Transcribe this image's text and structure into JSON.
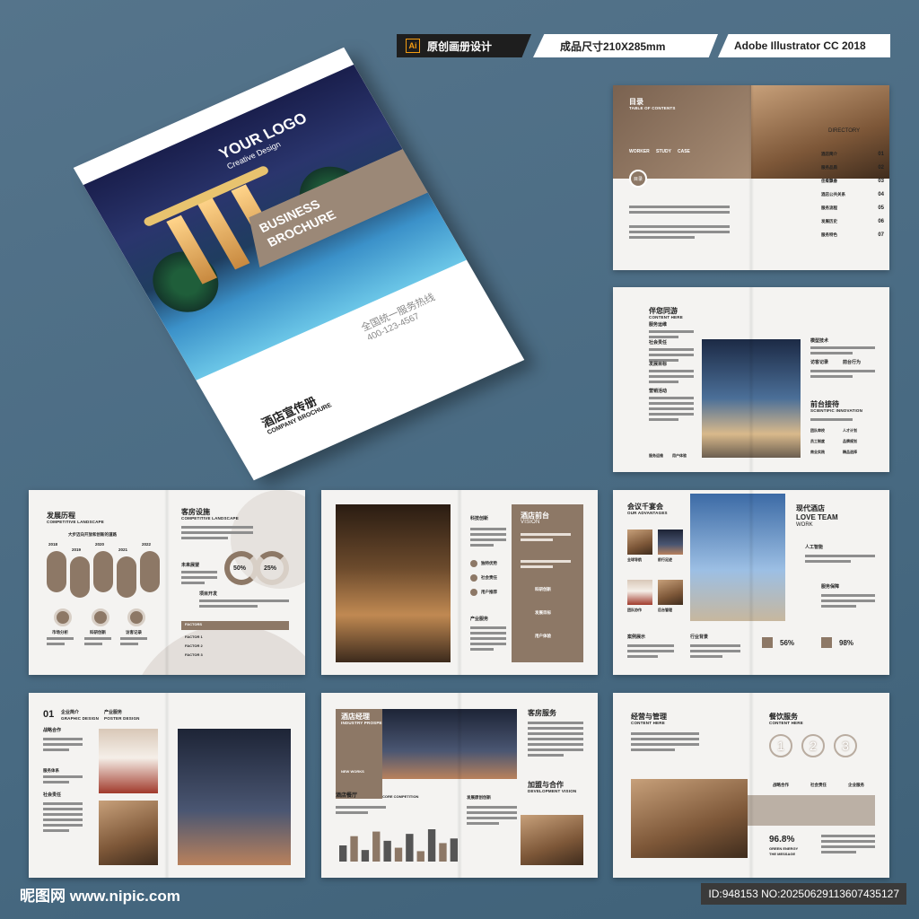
{
  "badges": {
    "tool": "Ai",
    "design": "原创画册设计",
    "size": "成品尺寸210X285mm",
    "software": "Adobe Illustrator CC 2018"
  },
  "cover": {
    "logo": "YOUR LOGO",
    "logo_sub": "Creative Design",
    "band_line1": "BUSINESS",
    "band_line2": "BROCHURE",
    "hotline_label": "全国统一服务热线",
    "hotline_number": "400-123-4567",
    "title": "酒店宣传册",
    "title_sub": "COMPANY BROCHURE"
  },
  "toc": {
    "title": "目录",
    "subtitle": "TABLE OF CONTENTS",
    "tabs": [
      "WORKER",
      "STUDY",
      "CASE"
    ],
    "chip": "目录",
    "directory": "DIRECTORY",
    "items": [
      {
        "label": "酒店简介",
        "sub": "PREFACE",
        "num": "01"
      },
      {
        "label": "服务品质",
        "sub": "COMPANY PROFILE",
        "num": "02"
      },
      {
        "label": "佳肴飘香",
        "sub": "OUR TEAM",
        "num": "03"
      },
      {
        "label": "酒店公共关系",
        "sub": "OUR SERVICE",
        "num": "04"
      },
      {
        "label": "服务流程",
        "sub": "SERVICE FLOW",
        "num": "05"
      },
      {
        "label": "发展历史",
        "sub": "DEVELOPMENT HISTORY",
        "num": "06"
      },
      {
        "label": "服务特色",
        "sub": "PRODUCT INTRODUCTION",
        "num": "07"
      }
    ]
  },
  "spread2": {
    "title": "伴您同游",
    "subtitle": "CONTENT HERE",
    "labels": [
      "服务运维",
      "社会责任",
      "发展目标",
      "营销活动"
    ],
    "bottom": [
      "服务运维",
      "用户体验"
    ],
    "right_labels": [
      "模型技术",
      "访客记录",
      "前台接待"
    ],
    "right_tag": "前台行为",
    "right_sub": "SCIENTIFIC INNOVATION",
    "table": [
      "团队审校",
      "人才计划",
      "员工制度",
      "品牌规划",
      "商业实践",
      "精品选择"
    ]
  },
  "spread3": {
    "title": "发展历程",
    "subtitle": "COMPETITIVE LANDSCAPE",
    "road": "大步迈向开放和创新的道路",
    "years": [
      "2018",
      "2019",
      "2020",
      "2021",
      "2022"
    ],
    "circles": [
      "市场分析",
      "科研创新",
      "访客记录"
    ],
    "title2": "客房设施",
    "subtitle2": "COMPETITIVE LANDSCAPE",
    "future": "未来展望",
    "project": "项目开发",
    "pct1": "50%",
    "pct2": "25%",
    "table_head": "FACTORS",
    "table_rows": [
      "FACTOR 1",
      "FACTOR 2",
      "FACTOR 3"
    ]
  },
  "spread4": {
    "label": "科技创新",
    "title": "酒店前台",
    "subtitle": "VISION",
    "labels": [
      "独特优势",
      "社会责任",
      "用户推荐"
    ],
    "product": "产业服务",
    "icons": [
      "科研创新",
      "发展目标",
      "用户体验"
    ]
  },
  "spread5": {
    "title": "会议千宴会",
    "subtitle": "OUR ADVANTAGES",
    "grid": [
      "全球导航",
      "前行足迹",
      "团队协作",
      "后台管理"
    ],
    "case": "案例展示",
    "industry": "行业背景",
    "title2": "现代酒店",
    "love": "LOVE TEAM",
    "work": "WORK",
    "talent": "人工智能",
    "service": "服务保障",
    "pct1": "56%",
    "pct2": "98%"
  },
  "spread6": {
    "num": "01",
    "title": "企业简介",
    "subtitle": "GRAPHIC DESIGN",
    "title2": "产业服务",
    "subtitle2": "POSTER DESIGN",
    "labels": [
      "战略合作",
      "服务体系",
      "社会责任"
    ]
  },
  "spread7": {
    "title": "酒店经理",
    "subtitle": "INDUSTRY PROSPECTS",
    "mini": "NEW WORKS",
    "title2": "客房服务",
    "dining": "酒店餐厅",
    "core": "CORE COMPETITION",
    "develop": "发展原创创新",
    "join": "加盟与合作",
    "join_sub": "DEVELOPMENT VISION",
    "bars": [
      14,
      22,
      10,
      26,
      18,
      12,
      24,
      9,
      28,
      16,
      20
    ]
  },
  "spread8": {
    "title": "经营与管理",
    "subtitle": "CONTENT HERE",
    "title2": "餐饮服务",
    "subtitle2": "CONTENT HERE",
    "digits": [
      "1",
      "2",
      "3"
    ],
    "icons": [
      "战略合作",
      "社会责任",
      "企业服务"
    ],
    "pct": "96.8%",
    "pct_sub1": "GREEN ENERGY",
    "pct_sub2": "THE MESSAGE"
  },
  "footer": {
    "left": "昵图网 www.nipic.com",
    "right": "ID:948153 NO:20250629113607435127"
  },
  "colors": {
    "accent": "#8d7866",
    "background": "#4c6d85",
    "paper": "#f4f3f1"
  }
}
